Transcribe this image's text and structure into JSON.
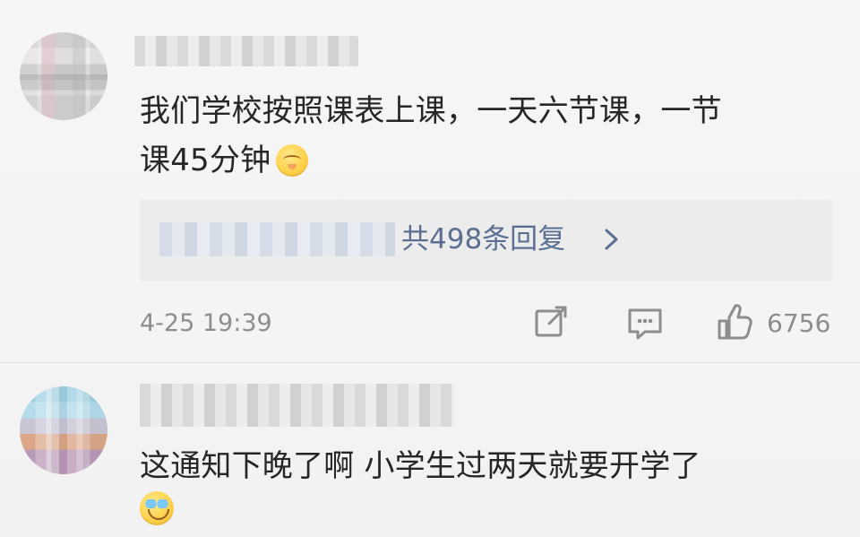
{
  "comments": [
    {
      "text_lines": [
        "我们学校按照课表上课，一天六节课，一节",
        "课45分钟"
      ],
      "emoji": "shy-face",
      "reply_summary": "共498条回复",
      "timestamp": "4-25 19:39",
      "like_count": "6756",
      "icons": {
        "share": "share-icon",
        "comment": "comment-icon",
        "like": "thumb-up-icon",
        "chevron": "chevron-right-icon"
      }
    },
    {
      "text_lines": [
        "这通知下晚了啊 小学生过两天就要开学了"
      ],
      "emoji": "laugh-cry-face"
    }
  ]
}
